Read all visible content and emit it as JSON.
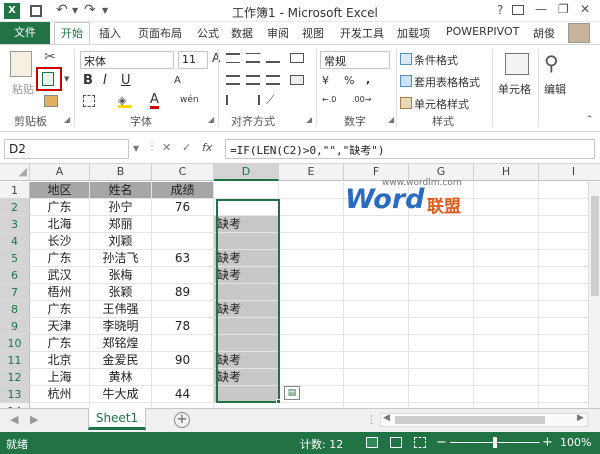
{
  "title_bar": {
    "title": "工作簿1 - Microsoft Excel",
    "help": "?",
    "minimize": "—",
    "restore": "❐",
    "close": "✕"
  },
  "tabs": {
    "file": "文件",
    "items": [
      "开始",
      "插入",
      "页面布局",
      "公式",
      "数据",
      "审阅",
      "视图",
      "开发工具",
      "加载项",
      "POWERPIVOT"
    ],
    "user": "胡俊"
  },
  "ribbon": {
    "clipboard": {
      "paste": "粘贴",
      "group_label": "剪贴板"
    },
    "font": {
      "font_name": "宋体",
      "font_size": "11",
      "bold": "B",
      "italic": "I",
      "underline": "U",
      "grow": "A",
      "shrink": "A",
      "font_color_glyph": "A",
      "wen": "wén",
      "group_label": "字体"
    },
    "align": {
      "group_label": "对齐方式"
    },
    "number": {
      "format": "常规",
      "currency": "¥",
      "percent": "%",
      "comma": ",",
      "inc": "←.0",
      "dec": ".00→",
      "group_label": "数字"
    },
    "styles": {
      "conditional": "条件格式",
      "table_format": "套用表格格式",
      "cell_styles": "单元格样式",
      "group_label": "样式"
    },
    "cells": {
      "label": "单元格"
    },
    "editing": {
      "label": "编辑"
    }
  },
  "formula_bar": {
    "name_box": "D2",
    "cancel": "✕",
    "enter": "✓",
    "fx": "fx",
    "formula": "=IF(LEN(C2)>0,\"\",\"缺考\")"
  },
  "watermark": {
    "url": "www.wordlm.com",
    "word": "Word",
    "brand": "联盟"
  },
  "sheet": {
    "columns": [
      "A",
      "B",
      "C",
      "D",
      "E",
      "F",
      "G",
      "H",
      "I"
    ],
    "rows": [
      "1",
      "2",
      "3",
      "4",
      "5",
      "6",
      "7",
      "8",
      "9",
      "10",
      "11",
      "12",
      "13",
      "14",
      "15"
    ],
    "cells": [
      [
        "地区",
        "姓名",
        "成绩",
        ""
      ],
      [
        "广东",
        "孙宁",
        "76",
        ""
      ],
      [
        "北海",
        "郑丽",
        "",
        "缺考"
      ],
      [
        "长沙",
        "刘颖",
        "",
        ""
      ],
      [
        "广东",
        "孙洁飞",
        "63",
        "缺考"
      ],
      [
        "武汉",
        "张梅",
        "",
        "缺考"
      ],
      [
        "梧州",
        "张颖",
        "89",
        ""
      ],
      [
        "广东",
        "王伟强",
        "",
        "缺考"
      ],
      [
        "天津",
        "李晓明",
        "78",
        ""
      ],
      [
        "广东",
        "郑铭煌",
        "",
        ""
      ],
      [
        "北京",
        "金爱民",
        "90",
        "缺考"
      ],
      [
        "上海",
        "黄林",
        "",
        "缺考"
      ],
      [
        "杭州",
        "牛大成",
        "44",
        ""
      ]
    ],
    "tab": "Sheet1",
    "add_sheet": "+"
  },
  "status": {
    "ready": "就绪",
    "count": "计数: 12",
    "zoom": "100%",
    "zoom_minus": "−",
    "zoom_plus": "+"
  },
  "colors": {
    "accent": "#217346",
    "header_fill": "#a6a6a6",
    "selection_fill": "#c8c8c8",
    "highlight_red": "#d00000"
  }
}
